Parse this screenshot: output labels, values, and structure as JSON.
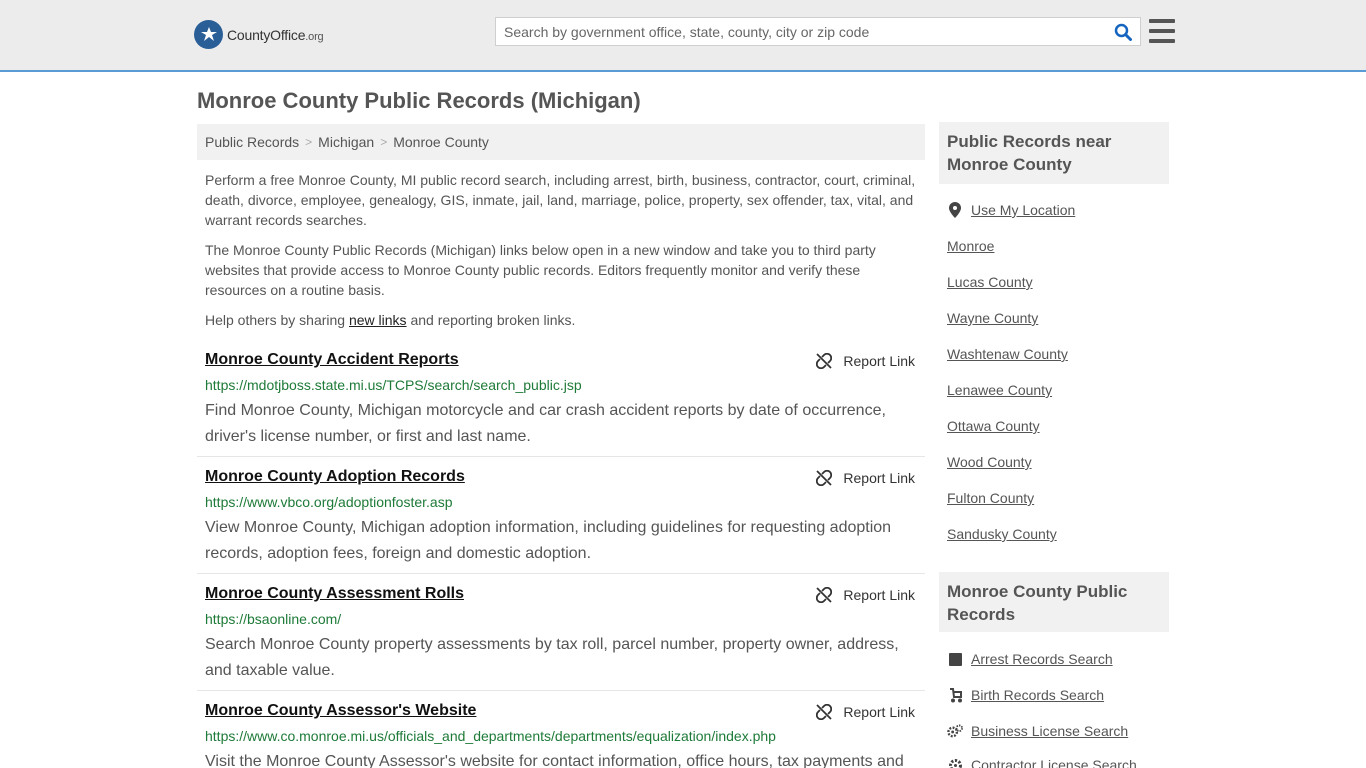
{
  "header": {
    "logo_name": "County",
    "logo_brand": "Office",
    "logo_org": ".org",
    "search_placeholder": "Search by government office, state, county, city or zip code"
  },
  "page_title": "Monroe County Public Records (Michigan)",
  "breadcrumb": [
    "Public Records",
    "Michigan",
    "Monroe County"
  ],
  "intro": {
    "p1": "Perform a free Monroe County, MI public record search, including arrest, birth, business, contractor, court, criminal, death, divorce, employee, genealogy, GIS, inmate, jail, land, marriage, police, property, sex offender, tax, vital, and warrant records searches.",
    "p2": "The Monroe County Public Records (Michigan) links below open in a new window and take you to third party websites that provide access to Monroe County public records. Editors frequently monitor and verify these resources on a routine basis.",
    "p3_before": "Help others by sharing ",
    "p3_link": "new links",
    "p3_after": " and reporting broken links."
  },
  "report_label": "Report Link",
  "records": [
    {
      "title": "Monroe County Accident Reports",
      "url": "https://mdotjboss.state.mi.us/TCPS/search/search_public.jsp",
      "desc": "Find Monroe County, Michigan motorcycle and car crash accident reports by date of occurrence, driver's license number, or first and last name."
    },
    {
      "title": "Monroe County Adoption Records",
      "url": "https://www.vbco.org/adoptionfoster.asp",
      "desc": "View Monroe County, Michigan adoption information, including guidelines for requesting adoption records, adoption fees, foreign and domestic adoption."
    },
    {
      "title": "Monroe County Assessment Rolls",
      "url": "https://bsaonline.com/",
      "desc": "Search Monroe County property assessments by tax roll, parcel number, property owner, address, and taxable value."
    },
    {
      "title": "Monroe County Assessor's Website",
      "url": "https://www.co.monroe.mi.us/officials_and_departments/departments/equalization/index.php",
      "desc": "Visit the Monroe County Assessor's website for contact information, office hours, tax payments and"
    }
  ],
  "sidebar": {
    "near_heading": "Public Records near Monroe County",
    "use_location": "Use My Location",
    "near_links": [
      "Monroe",
      "Lucas County",
      "Wayne County",
      "Washtenaw County",
      "Lenawee County",
      "Ottawa County",
      "Wood County",
      "Fulton County",
      "Sandusky County"
    ],
    "records_heading": "Monroe County Public Records",
    "record_links": [
      {
        "label": "Arrest Records Search",
        "icon": "square-icon"
      },
      {
        "label": "Birth Records Search",
        "icon": "stroller-icon"
      },
      {
        "label": "Business License Search",
        "icon": "gears-icon"
      },
      {
        "label": "Contractor License Search",
        "icon": "gear-icon"
      }
    ]
  },
  "colors": {
    "accent": "#5b9bd5",
    "url_green": "#1e7a38",
    "logo_blue": "#2a5e97"
  }
}
